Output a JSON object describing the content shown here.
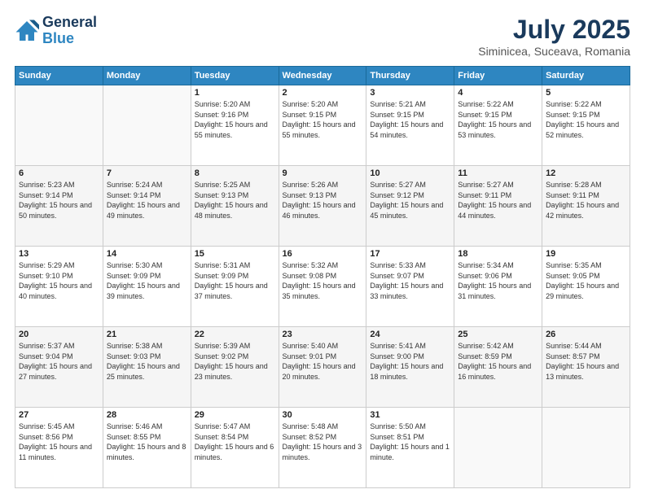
{
  "logo": {
    "line1": "General",
    "line2": "Blue"
  },
  "title": "July 2025",
  "subtitle": "Siminicea, Suceava, Romania",
  "weekdays": [
    "Sunday",
    "Monday",
    "Tuesday",
    "Wednesday",
    "Thursday",
    "Friday",
    "Saturday"
  ],
  "weeks": [
    [
      {
        "day": "",
        "sunrise": "",
        "sunset": "",
        "daylight": ""
      },
      {
        "day": "",
        "sunrise": "",
        "sunset": "",
        "daylight": ""
      },
      {
        "day": "1",
        "sunrise": "Sunrise: 5:20 AM",
        "sunset": "Sunset: 9:16 PM",
        "daylight": "Daylight: 15 hours and 55 minutes."
      },
      {
        "day": "2",
        "sunrise": "Sunrise: 5:20 AM",
        "sunset": "Sunset: 9:15 PM",
        "daylight": "Daylight: 15 hours and 55 minutes."
      },
      {
        "day": "3",
        "sunrise": "Sunrise: 5:21 AM",
        "sunset": "Sunset: 9:15 PM",
        "daylight": "Daylight: 15 hours and 54 minutes."
      },
      {
        "day": "4",
        "sunrise": "Sunrise: 5:22 AM",
        "sunset": "Sunset: 9:15 PM",
        "daylight": "Daylight: 15 hours and 53 minutes."
      },
      {
        "day": "5",
        "sunrise": "Sunrise: 5:22 AM",
        "sunset": "Sunset: 9:15 PM",
        "daylight": "Daylight: 15 hours and 52 minutes."
      }
    ],
    [
      {
        "day": "6",
        "sunrise": "Sunrise: 5:23 AM",
        "sunset": "Sunset: 9:14 PM",
        "daylight": "Daylight: 15 hours and 50 minutes."
      },
      {
        "day": "7",
        "sunrise": "Sunrise: 5:24 AM",
        "sunset": "Sunset: 9:14 PM",
        "daylight": "Daylight: 15 hours and 49 minutes."
      },
      {
        "day": "8",
        "sunrise": "Sunrise: 5:25 AM",
        "sunset": "Sunset: 9:13 PM",
        "daylight": "Daylight: 15 hours and 48 minutes."
      },
      {
        "day": "9",
        "sunrise": "Sunrise: 5:26 AM",
        "sunset": "Sunset: 9:13 PM",
        "daylight": "Daylight: 15 hours and 46 minutes."
      },
      {
        "day": "10",
        "sunrise": "Sunrise: 5:27 AM",
        "sunset": "Sunset: 9:12 PM",
        "daylight": "Daylight: 15 hours and 45 minutes."
      },
      {
        "day": "11",
        "sunrise": "Sunrise: 5:27 AM",
        "sunset": "Sunset: 9:11 PM",
        "daylight": "Daylight: 15 hours and 44 minutes."
      },
      {
        "day": "12",
        "sunrise": "Sunrise: 5:28 AM",
        "sunset": "Sunset: 9:11 PM",
        "daylight": "Daylight: 15 hours and 42 minutes."
      }
    ],
    [
      {
        "day": "13",
        "sunrise": "Sunrise: 5:29 AM",
        "sunset": "Sunset: 9:10 PM",
        "daylight": "Daylight: 15 hours and 40 minutes."
      },
      {
        "day": "14",
        "sunrise": "Sunrise: 5:30 AM",
        "sunset": "Sunset: 9:09 PM",
        "daylight": "Daylight: 15 hours and 39 minutes."
      },
      {
        "day": "15",
        "sunrise": "Sunrise: 5:31 AM",
        "sunset": "Sunset: 9:09 PM",
        "daylight": "Daylight: 15 hours and 37 minutes."
      },
      {
        "day": "16",
        "sunrise": "Sunrise: 5:32 AM",
        "sunset": "Sunset: 9:08 PM",
        "daylight": "Daylight: 15 hours and 35 minutes."
      },
      {
        "day": "17",
        "sunrise": "Sunrise: 5:33 AM",
        "sunset": "Sunset: 9:07 PM",
        "daylight": "Daylight: 15 hours and 33 minutes."
      },
      {
        "day": "18",
        "sunrise": "Sunrise: 5:34 AM",
        "sunset": "Sunset: 9:06 PM",
        "daylight": "Daylight: 15 hours and 31 minutes."
      },
      {
        "day": "19",
        "sunrise": "Sunrise: 5:35 AM",
        "sunset": "Sunset: 9:05 PM",
        "daylight": "Daylight: 15 hours and 29 minutes."
      }
    ],
    [
      {
        "day": "20",
        "sunrise": "Sunrise: 5:37 AM",
        "sunset": "Sunset: 9:04 PM",
        "daylight": "Daylight: 15 hours and 27 minutes."
      },
      {
        "day": "21",
        "sunrise": "Sunrise: 5:38 AM",
        "sunset": "Sunset: 9:03 PM",
        "daylight": "Daylight: 15 hours and 25 minutes."
      },
      {
        "day": "22",
        "sunrise": "Sunrise: 5:39 AM",
        "sunset": "Sunset: 9:02 PM",
        "daylight": "Daylight: 15 hours and 23 minutes."
      },
      {
        "day": "23",
        "sunrise": "Sunrise: 5:40 AM",
        "sunset": "Sunset: 9:01 PM",
        "daylight": "Daylight: 15 hours and 20 minutes."
      },
      {
        "day": "24",
        "sunrise": "Sunrise: 5:41 AM",
        "sunset": "Sunset: 9:00 PM",
        "daylight": "Daylight: 15 hours and 18 minutes."
      },
      {
        "day": "25",
        "sunrise": "Sunrise: 5:42 AM",
        "sunset": "Sunset: 8:59 PM",
        "daylight": "Daylight: 15 hours and 16 minutes."
      },
      {
        "day": "26",
        "sunrise": "Sunrise: 5:44 AM",
        "sunset": "Sunset: 8:57 PM",
        "daylight": "Daylight: 15 hours and 13 minutes."
      }
    ],
    [
      {
        "day": "27",
        "sunrise": "Sunrise: 5:45 AM",
        "sunset": "Sunset: 8:56 PM",
        "daylight": "Daylight: 15 hours and 11 minutes."
      },
      {
        "day": "28",
        "sunrise": "Sunrise: 5:46 AM",
        "sunset": "Sunset: 8:55 PM",
        "daylight": "Daylight: 15 hours and 8 minutes."
      },
      {
        "day": "29",
        "sunrise": "Sunrise: 5:47 AM",
        "sunset": "Sunset: 8:54 PM",
        "daylight": "Daylight: 15 hours and 6 minutes."
      },
      {
        "day": "30",
        "sunrise": "Sunrise: 5:48 AM",
        "sunset": "Sunset: 8:52 PM",
        "daylight": "Daylight: 15 hours and 3 minutes."
      },
      {
        "day": "31",
        "sunrise": "Sunrise: 5:50 AM",
        "sunset": "Sunset: 8:51 PM",
        "daylight": "Daylight: 15 hours and 1 minute."
      },
      {
        "day": "",
        "sunrise": "",
        "sunset": "",
        "daylight": ""
      },
      {
        "day": "",
        "sunrise": "",
        "sunset": "",
        "daylight": ""
      }
    ]
  ]
}
